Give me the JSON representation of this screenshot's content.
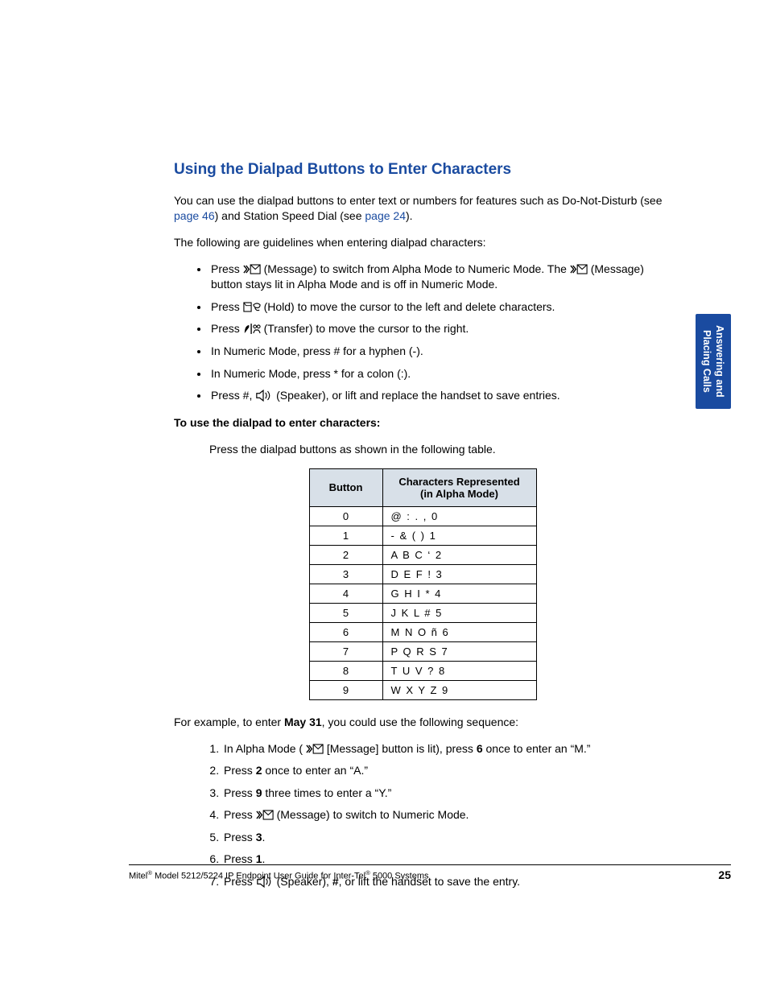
{
  "sideTab": {
    "line1": "Answering and",
    "line2": "Placing Calls"
  },
  "heading": "Using the Dialpad Buttons to Enter Characters",
  "intro": {
    "pre": "You can use the dialpad buttons to enter text or numbers for features such as Do-Not-Disturb (see ",
    "link1": "page 46",
    "mid": ") and Station Speed Dial (see ",
    "link2": "page 24",
    "post": ")."
  },
  "guidelinesLead": "The following are guidelines when entering dialpad characters:",
  "bullets": {
    "b1": {
      "pre": "Press ",
      "iconLabel1": "(Message)",
      "mid": " to switch from Alpha Mode to Numeric Mode. The ",
      "iconLabel2": "(Message)",
      "post": " button stays lit in Alpha Mode and is off in Numeric Mode."
    },
    "b2": {
      "pre": "Press ",
      "iconLabel": "(Hold)",
      "post": " to move the cursor to the left and delete characters."
    },
    "b3": {
      "pre": "Press ",
      "iconLabel": "(Transfer)",
      "post": " to move the cursor to the right."
    },
    "b4": "In Numeric Mode, press # for a hyphen (-).",
    "b5": "In Numeric Mode, press * for a colon (:).",
    "b6": {
      "pre": "Press #, ",
      "iconLabel": "(Speaker)",
      "post": ", or lift and replace the handset to save entries."
    }
  },
  "procTitle": "To use the dialpad to enter characters:",
  "procStep": "Press the dialpad buttons as shown in the following table.",
  "table": {
    "head": {
      "col1": "Button",
      "col2a": "Characters Represented",
      "col2b": "(in Alpha Mode)"
    },
    "rows": [
      {
        "btn": "0",
        "chars": "@ : . , 0"
      },
      {
        "btn": "1",
        "chars": "- & ( ) 1"
      },
      {
        "btn": "2",
        "chars": "A B C ‘ 2"
      },
      {
        "btn": "3",
        "chars": "D E F ! 3"
      },
      {
        "btn": "4",
        "chars": "G H I * 4"
      },
      {
        "btn": "5",
        "chars": "J K L # 5"
      },
      {
        "btn": "6",
        "chars": "M N O ñ 6"
      },
      {
        "btn": "7",
        "chars": "P Q R S 7"
      },
      {
        "btn": "8",
        "chars": "T U V ? 8"
      },
      {
        "btn": "9",
        "chars": "W X Y Z 9"
      }
    ]
  },
  "example": {
    "lead_pre": "For example, to enter ",
    "lead_bold": "May 31",
    "lead_post": ", you could use the following sequence:",
    "steps": {
      "s1": {
        "pre": "In Alpha Mode (",
        "iconLabel": "[Message]",
        "mid": " button is lit), press ",
        "b": "6",
        "post": " once to enter an “M.”"
      },
      "s2": {
        "pre": "Press ",
        "b": "2",
        "post": " once to enter an “A.”"
      },
      "s3": {
        "pre": "Press ",
        "b": "9",
        "post": " three times to enter a “Y.”"
      },
      "s4": {
        "pre": "Press ",
        "iconLabel": "(Message)",
        "post": " to switch to Numeric Mode."
      },
      "s5": {
        "pre": "Press ",
        "b": "3",
        "post": "."
      },
      "s6": {
        "pre": "Press ",
        "b": "1",
        "post": "."
      },
      "s7": {
        "pre": "Press ",
        "iconLabel": "(Speaker)",
        "mid": ", ",
        "b": "#",
        "post": ", or lift the handset to save the entry."
      }
    }
  },
  "footer": {
    "text_pre": "Mitel",
    "text_mid": " Model 5212/5224 IP Endpoint User Guide for Inter-Tel",
    "text_post": " 5000 Systems",
    "pageNum": "25"
  }
}
